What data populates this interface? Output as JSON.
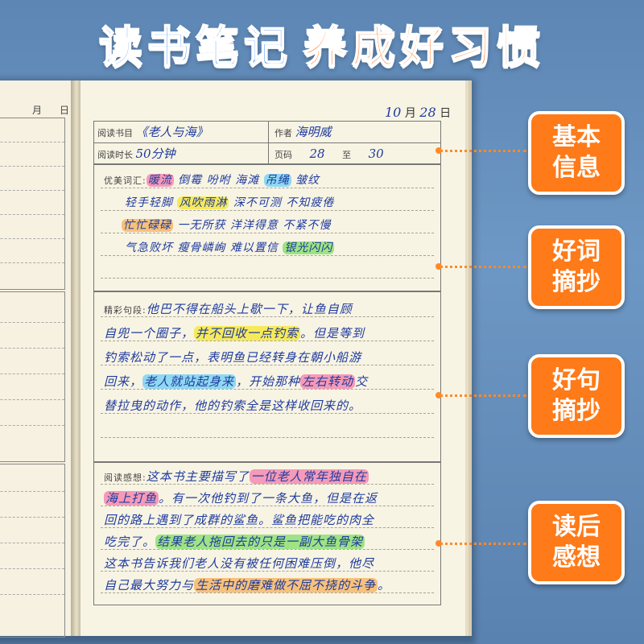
{
  "headline": {
    "part1": "读书笔记",
    "part2": "养成好习惯"
  },
  "left_page": {
    "month": "月",
    "day": "日"
  },
  "date": {
    "month": "10",
    "month_label": "月",
    "day": "28",
    "day_label": "日"
  },
  "info": {
    "book_label": "阅读书目",
    "book_value": "《老人与海》",
    "author_label": "作者",
    "author_value": "海明威",
    "time_label": "阅读时长",
    "time_value": "50分钟",
    "pages_label": "页码",
    "page_from": "28",
    "page_to_label": "至",
    "page_to": "30"
  },
  "words": {
    "label": "优美词汇:",
    "lines": [
      [
        {
          "t": "暖流",
          "hl": "pink"
        },
        {
          "t": " 倒霉 吩咐 海滩 "
        },
        {
          "t": "吊绳",
          "hl": "blue"
        },
        {
          "t": " 皱纹"
        }
      ],
      [
        {
          "t": "轻手轻脚 "
        },
        {
          "t": "风吹雨淋",
          "hl": "yellow"
        },
        {
          "t": " 深不可测 不知疲倦"
        }
      ],
      [
        {
          "t": "忙忙碌碌",
          "hl": "orange"
        },
        {
          "t": " 一无所获 洋洋得意 不紧不慢"
        }
      ],
      [
        {
          "t": "气急败坏 瘦骨嶙峋 难以置信 "
        },
        {
          "t": "银光闪闪",
          "hl": "green"
        }
      ]
    ]
  },
  "sentences": {
    "label": "精彩句段:",
    "lines": [
      [
        {
          "t": "他巴不得在船头上歇一下，让鱼自顾"
        }
      ],
      [
        {
          "t": "自兜一个圈子，"
        },
        {
          "t": "并不回收一点钓索",
          "hl": "yellow"
        },
        {
          "t": "。但是等到"
        }
      ],
      [
        {
          "t": "钓索松动了一点，表明鱼已经转身在朝小船游"
        }
      ],
      [
        {
          "t": "回来，"
        },
        {
          "t": "老人就站起身来",
          "hl": "blue"
        },
        {
          "t": "，开始那种"
        },
        {
          "t": "左右转动",
          "hl": "pink"
        },
        {
          "t": "交"
        }
      ],
      [
        {
          "t": "替拉曳的动作，他的钓索全是这样收回来的。"
        }
      ]
    ]
  },
  "thoughts": {
    "label": "阅读感想:",
    "lines": [
      [
        {
          "t": "这本书主要描写了"
        },
        {
          "t": "一位老人常年独自在",
          "hl": "pink"
        }
      ],
      [
        {
          "t": "海上打鱼",
          "hl": "pink"
        },
        {
          "t": "。有一次他钓到了一条大鱼，但是在返"
        }
      ],
      [
        {
          "t": "回的路上遇到了成群的鲨鱼。鲨鱼把能吃的肉全"
        }
      ],
      [
        {
          "t": "吃完了。"
        },
        {
          "t": "结果老人拖回去的只是一副大鱼骨架",
          "hl": "green"
        }
      ],
      [
        {
          "t": "这本书告诉我们老人没有被任何困难压倒，他尽"
        }
      ],
      [
        {
          "t": "自己最大努力与"
        },
        {
          "t": "生活中的磨难做不屈不挠的斗争",
          "hl": "orange"
        },
        {
          "t": "。"
        }
      ]
    ]
  },
  "callouts": [
    {
      "line1": "基本",
      "line2": "信息"
    },
    {
      "line1": "好词",
      "line2": "摘抄"
    },
    {
      "line1": "好句",
      "line2": "摘抄"
    },
    {
      "line1": "读后",
      "line2": "感想"
    }
  ],
  "colors": {
    "accent": "#ff7a18",
    "title_blue": "#2f7ff0",
    "title_orange": "#ff6a10",
    "ink": "#1e3b9e"
  }
}
